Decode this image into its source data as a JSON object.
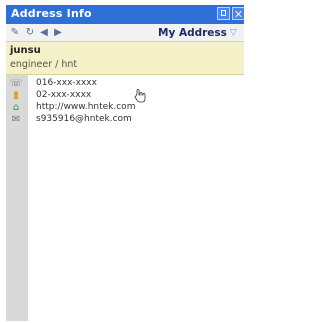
{
  "window": {
    "title": "Address Info"
  },
  "toolbar": {
    "dropdown_label": "My Address"
  },
  "contact": {
    "name": "junsu",
    "job": "engineer / hnt",
    "entries": [
      {
        "icon": "phone-icon",
        "value": "016-xxx-xxxx"
      },
      {
        "icon": "mobile-icon",
        "value": "02-xxx-xxxx"
      },
      {
        "icon": "home-icon",
        "value": "http://www.hntek.com"
      },
      {
        "icon": "email-icon",
        "value": "s935916@hntek.com"
      }
    ]
  }
}
